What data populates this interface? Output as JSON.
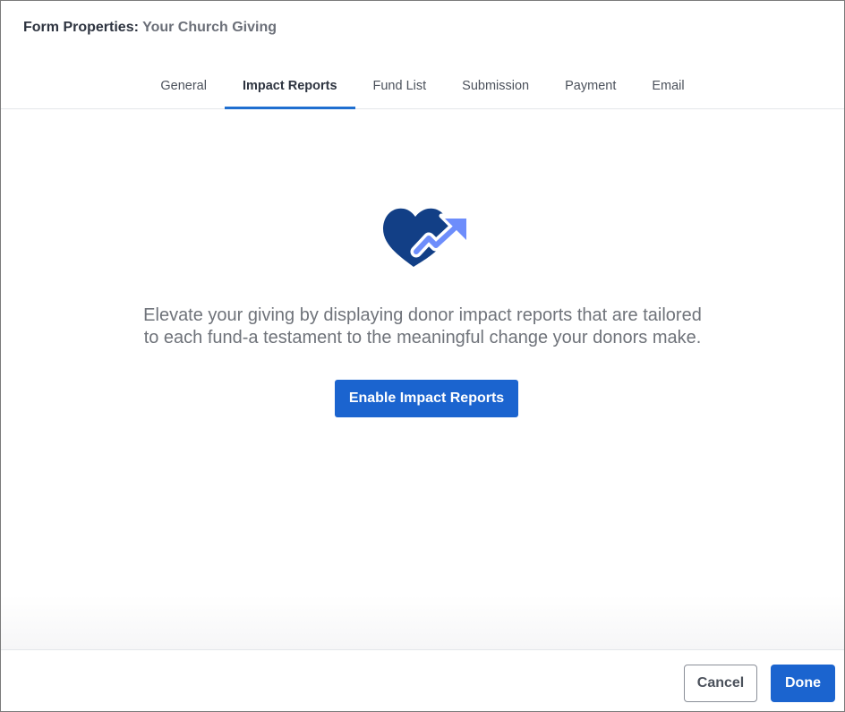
{
  "header": {
    "label": "Form Properties:",
    "form_name": "Your Church Giving"
  },
  "tabs": [
    {
      "label": "General",
      "active": false
    },
    {
      "label": "Impact Reports",
      "active": true
    },
    {
      "label": "Fund List",
      "active": false
    },
    {
      "label": "Submission",
      "active": false
    },
    {
      "label": "Payment",
      "active": false
    },
    {
      "label": "Email",
      "active": false
    }
  ],
  "main": {
    "icon": "heart-trend-up-icon",
    "description_line1": "Elevate your giving by displaying donor impact reports that are tailored",
    "description_line2": "to each fund-a testament to the meaningful change your donors make.",
    "enable_button": "Enable Impact Reports"
  },
  "footer": {
    "cancel_label": "Cancel",
    "done_label": "Done"
  },
  "colors": {
    "accent": "#1b64cf",
    "heart": "#123f86",
    "arrow": "#6d8dfb",
    "tab_underline": "#1f6fd0"
  }
}
